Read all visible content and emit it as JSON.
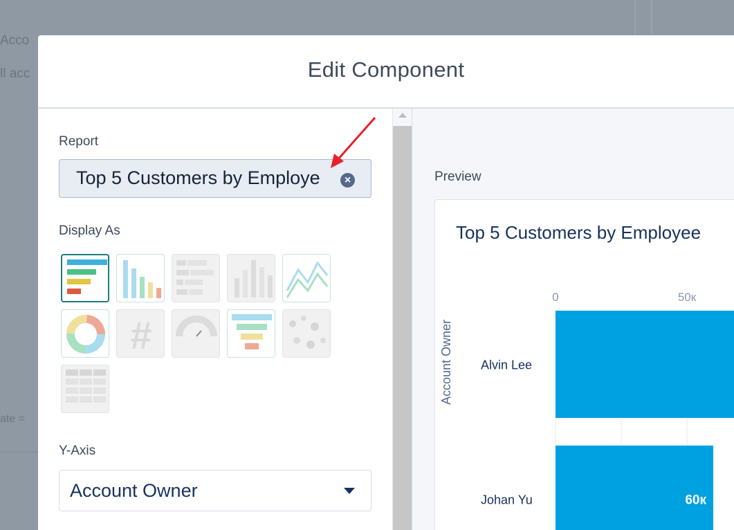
{
  "background": {
    "card_title": "Acco",
    "card_subtitle": "ll acc",
    "filter_text": "ate ="
  },
  "modal": {
    "title": "Edit Component"
  },
  "form": {
    "report_label": "Report",
    "report_value": "Top 5 Customers by Employe",
    "clear_icon": "×",
    "display_as_label": "Display As",
    "display_options": [
      {
        "name": "horizontal-bar-chart",
        "state": "selected"
      },
      {
        "name": "vertical-bar-chart",
        "state": "available"
      },
      {
        "name": "stacked-horizontal-bar-chart",
        "state": "disabled"
      },
      {
        "name": "stacked-vertical-bar-chart",
        "state": "disabled"
      },
      {
        "name": "line-chart",
        "state": "available"
      },
      {
        "name": "donut-chart",
        "state": "available"
      },
      {
        "name": "metric",
        "state": "disabled"
      },
      {
        "name": "gauge",
        "state": "disabled"
      },
      {
        "name": "funnel-chart",
        "state": "available"
      },
      {
        "name": "scatter-chart",
        "state": "disabled"
      },
      {
        "name": "table",
        "state": "disabled"
      }
    ],
    "y_axis_label": "Y-Axis",
    "y_axis_value": "Account Owner"
  },
  "preview": {
    "label": "Preview"
  },
  "chart_data": {
    "type": "bar",
    "orientation": "horizontal",
    "title": "Top 5 Customers by Employee",
    "ylabel": "Account Owner",
    "xlabel": "",
    "x_ticks": [
      "0",
      "50к"
    ],
    "categories": [
      "Alvin Lee",
      "Johan Yu"
    ],
    "values": [
      null,
      60000
    ],
    "data_labels": [
      "",
      "60к"
    ],
    "bar_color": "#00a1e0"
  },
  "colors": {
    "accent": "#00a1e0",
    "selected_tile_border": "#1b7b82",
    "annotation_arrow": "#e8202a"
  }
}
